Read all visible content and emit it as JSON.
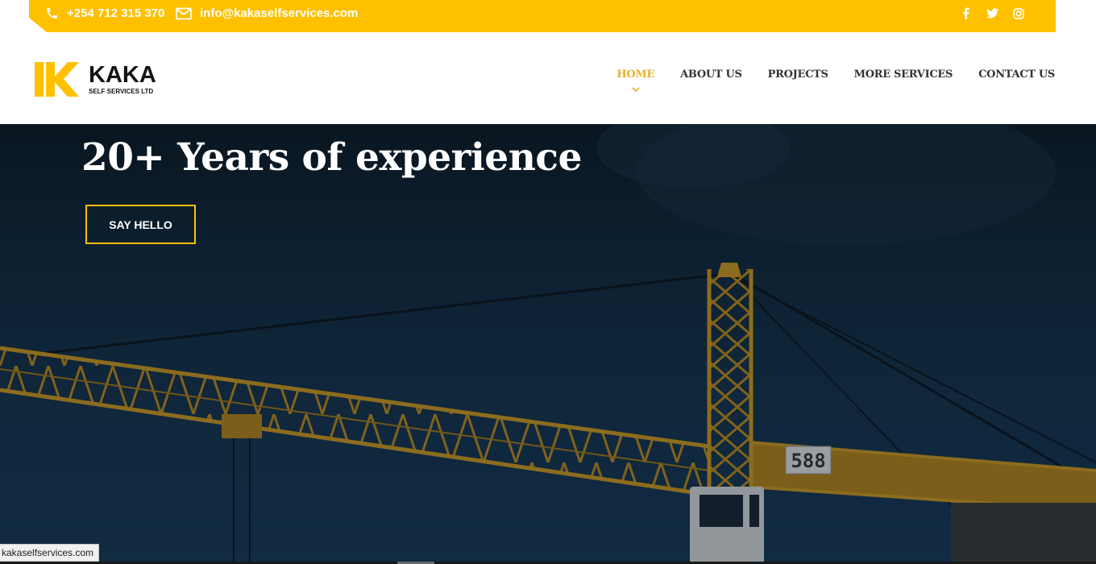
{
  "topbar": {
    "phone": "+254 712 315 370",
    "email": "info@kakaselfservices.com",
    "phone_icon": "phone-icon",
    "email_icon": "envelope-icon",
    "socials": [
      "facebook-icon",
      "twitter-icon",
      "instagram-icon"
    ],
    "background_color": "#ffc000"
  },
  "brand": {
    "name": "KAKA",
    "tagline": "SELF SERVICES LTD",
    "logo_letter": "K",
    "logo_color": "#ffc000"
  },
  "nav": {
    "items": [
      {
        "label": "HOME",
        "active": true
      },
      {
        "label": "ABOUT US",
        "active": false
      },
      {
        "label": "PROJECTS",
        "active": false
      },
      {
        "label": "MORE SERVICES",
        "active": false
      },
      {
        "label": "CONTACT US",
        "active": false
      }
    ],
    "active_color": "#e8b02b"
  },
  "hero": {
    "title": "20+ Years of experience",
    "cta_label": "SAY HELLO",
    "cta_border_color": "#ffc000",
    "crane_sign": "588"
  },
  "status": {
    "url": "kakaselfservices.com"
  }
}
